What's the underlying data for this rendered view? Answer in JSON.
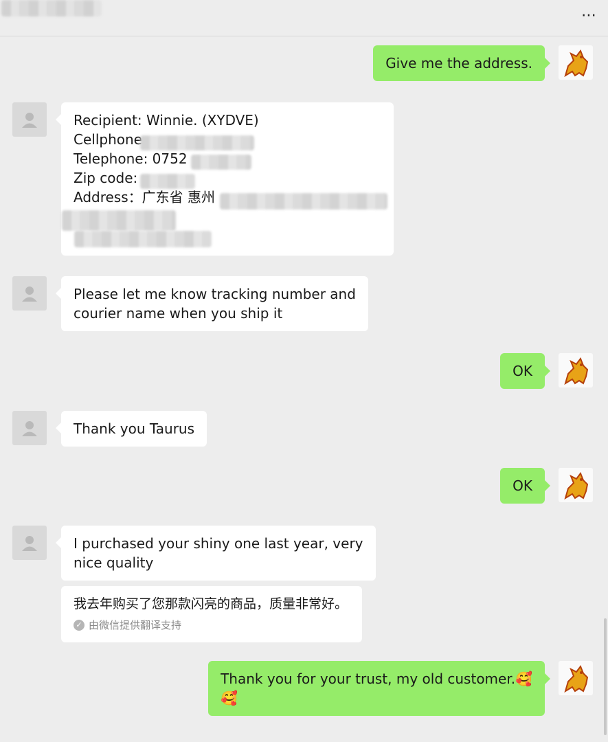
{
  "header": {
    "title_hidden": true,
    "more_icon": "⋯"
  },
  "messages": [
    {
      "id": "m1",
      "side": "out",
      "text": "Give me the address."
    },
    {
      "id": "m2",
      "side": "in",
      "lines": [
        "Recipient: Winnie. (XYDVE)",
        "Cellphone",
        "Telephone: 0752",
        "Zip code:",
        "Address：广东省 惠州"
      ]
    },
    {
      "id": "m3",
      "side": "in",
      "lines": [
        "Please let me know tracking number and",
        "courier name when you ship it"
      ]
    },
    {
      "id": "m4",
      "side": "out",
      "text": "OK"
    },
    {
      "id": "m5",
      "side": "in",
      "text": "Thank you Taurus"
    },
    {
      "id": "m6",
      "side": "out",
      "text": "OK"
    },
    {
      "id": "m7",
      "side": "in",
      "lines": [
        "I purchased your shiny one last year, very",
        "nice quality"
      ]
    },
    {
      "id": "m8",
      "side": "out",
      "lines": [
        "Thank you for your trust, my old customer.",
        ""
      ],
      "emoji": "🥰"
    }
  ],
  "translation": {
    "text": "我去年购买了您那款闪亮的商品，质量非常好。",
    "note": "由微信提供翻译支持"
  },
  "colors": {
    "incoming": "#ffffff",
    "outgoing": "#95ec69",
    "background": "#ededed"
  }
}
